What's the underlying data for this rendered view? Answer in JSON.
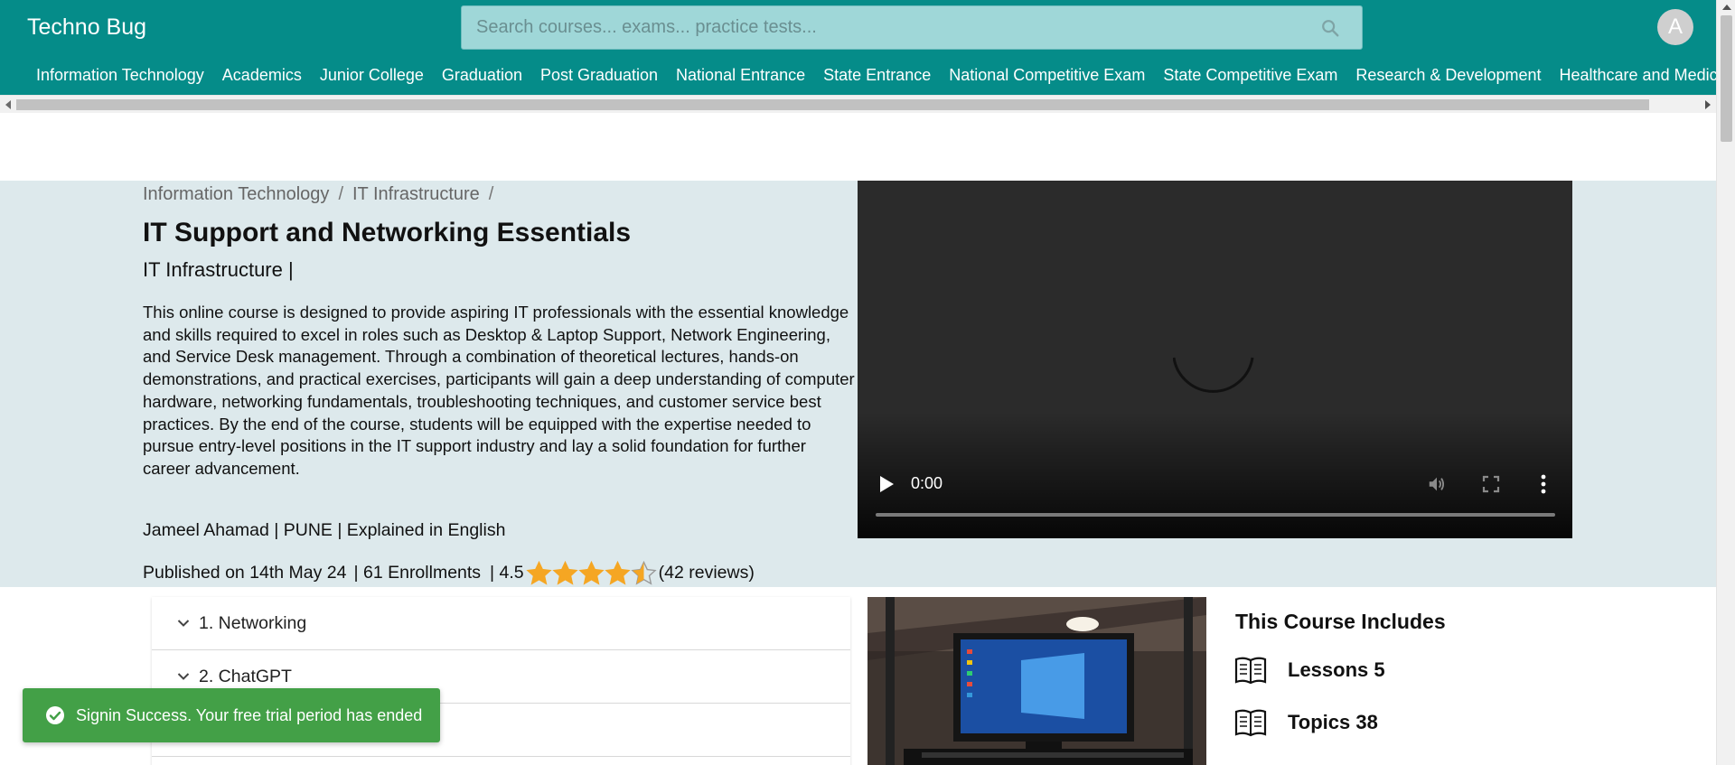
{
  "header": {
    "brand": "Techno Bug",
    "search_placeholder": "Search courses... exams... practice tests...",
    "avatar_initial": "A"
  },
  "categories": [
    "Information Technology",
    "Academics",
    "Junior College",
    "Graduation",
    "Post Graduation",
    "National Entrance",
    "State Entrance",
    "National Competitive Exam",
    "State Competitive Exam",
    "Research & Development",
    "Healthcare and Medicine"
  ],
  "breadcrumb": {
    "items": [
      "Information Technology",
      "IT Infrastructure"
    ],
    "separator": "/"
  },
  "course": {
    "title": "IT Support and Networking Essentials",
    "subtitle": "IT Infrastructure |",
    "description": "This online course is designed to provide aspiring IT professionals with the essential knowledge and skills required to excel in roles such as Desktop & Laptop Support, Network Engineering, and Service Desk management. Through a combination of theoretical lectures, hands-on demonstrations, and practical exercises, participants will gain a deep understanding of computer hardware, networking fundamentals, troubleshooting techniques, and customer service best practices. By the end of the course, students will be equipped with the expertise needed to pursue entry-level positions in the IT support industry and lay a solid foundation for further career advancement.",
    "meta": "Jameel Ahamad | PUNE | Explained in English",
    "published": "Published on 14th May 24",
    "enrollments": "| 61 Enrollments",
    "rating_text": "| 4.5",
    "rating_value": 4.5,
    "rating_max": 5,
    "reviews": "(42 reviews)"
  },
  "video": {
    "time": "0:00",
    "progress": 0
  },
  "lessons": [
    {
      "label": "1. Networking"
    },
    {
      "label": "2. ChatGPT"
    },
    {
      "label": ""
    }
  ],
  "includes": {
    "title": "This Course Includes",
    "items": [
      {
        "label": "Lessons 5",
        "icon": "book-icon"
      },
      {
        "label": "Topics 38",
        "icon": "book-icon"
      }
    ]
  },
  "toast": {
    "message": "Signin Success. Your free trial period has ended"
  },
  "colors": {
    "brand": "#058c89",
    "hero_bg": "#dde9ec",
    "star": "#f5a623",
    "toast": "#43a047"
  }
}
